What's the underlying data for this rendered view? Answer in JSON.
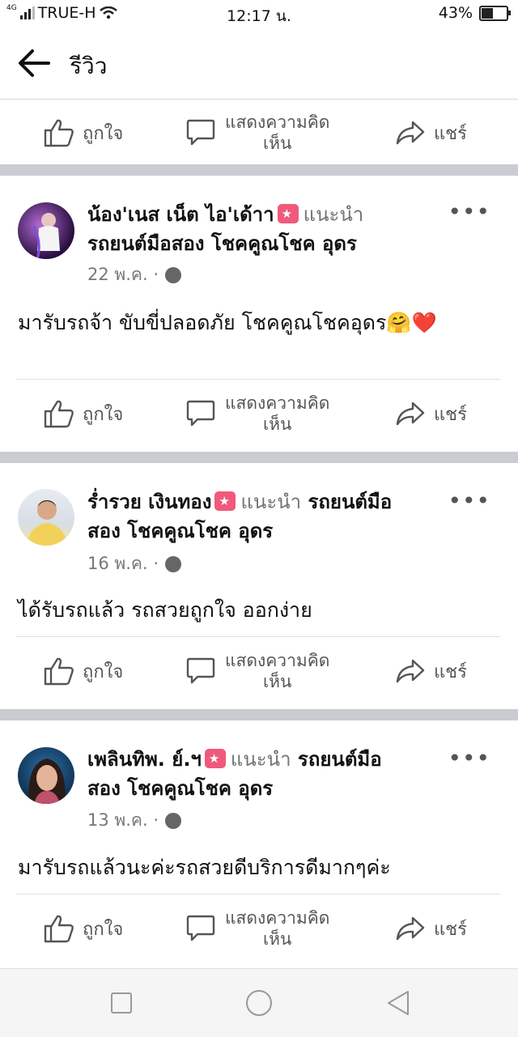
{
  "status": {
    "network": "4G",
    "carrier": "TRUE-H",
    "time": "12:17 น.",
    "battery": "43%",
    "battery_level": 0.43
  },
  "header": {
    "title": "รีวิว"
  },
  "actions": {
    "like": "ถูกใจ",
    "comment_line1": "แสดงความคิด",
    "comment_line2": "เห็น",
    "share": "แชร์"
  },
  "posts": [
    {
      "name": "น้อง'เนส เน็ต ไอ'เด้าา",
      "recommends": "แนะนำ",
      "page": "รถยนต์มือสอง โชคคูณโชค อุดร",
      "date": "22 พ.ค. ·",
      "text": "มารับรถจ้า ขับขี่ปลอดภัย โชคคูณโชคอุดร🤗❤️"
    },
    {
      "name": "ร่ำรวย เงินทอง",
      "recommends": "แนะนำ",
      "page_line1": "รถยนต์มือ",
      "page_line2": "สอง โชคคูณโชค อุดร",
      "date": "16 พ.ค. ·",
      "text": "ได้รับรถแล้ว รถสวยถูกใจ ออกง่าย"
    },
    {
      "name": "เพลินทิพ. ย์.ฯ",
      "recommends": "แนะนำ",
      "page_line1": "รถยนต์มือ",
      "page_line2": "สอง โชคคูณโชค อุดร",
      "date": "13 พ.ค. ·",
      "text": "มารับรถแล้วนะค่ะรถสวยดีบริการดีมากๆค่ะ"
    }
  ],
  "icons": {
    "like": "thumbs-up-icon",
    "comment": "comment-bubble-icon",
    "share": "share-arrow-icon",
    "more": "more-dots-icon",
    "privacy": "globe-icon"
  }
}
